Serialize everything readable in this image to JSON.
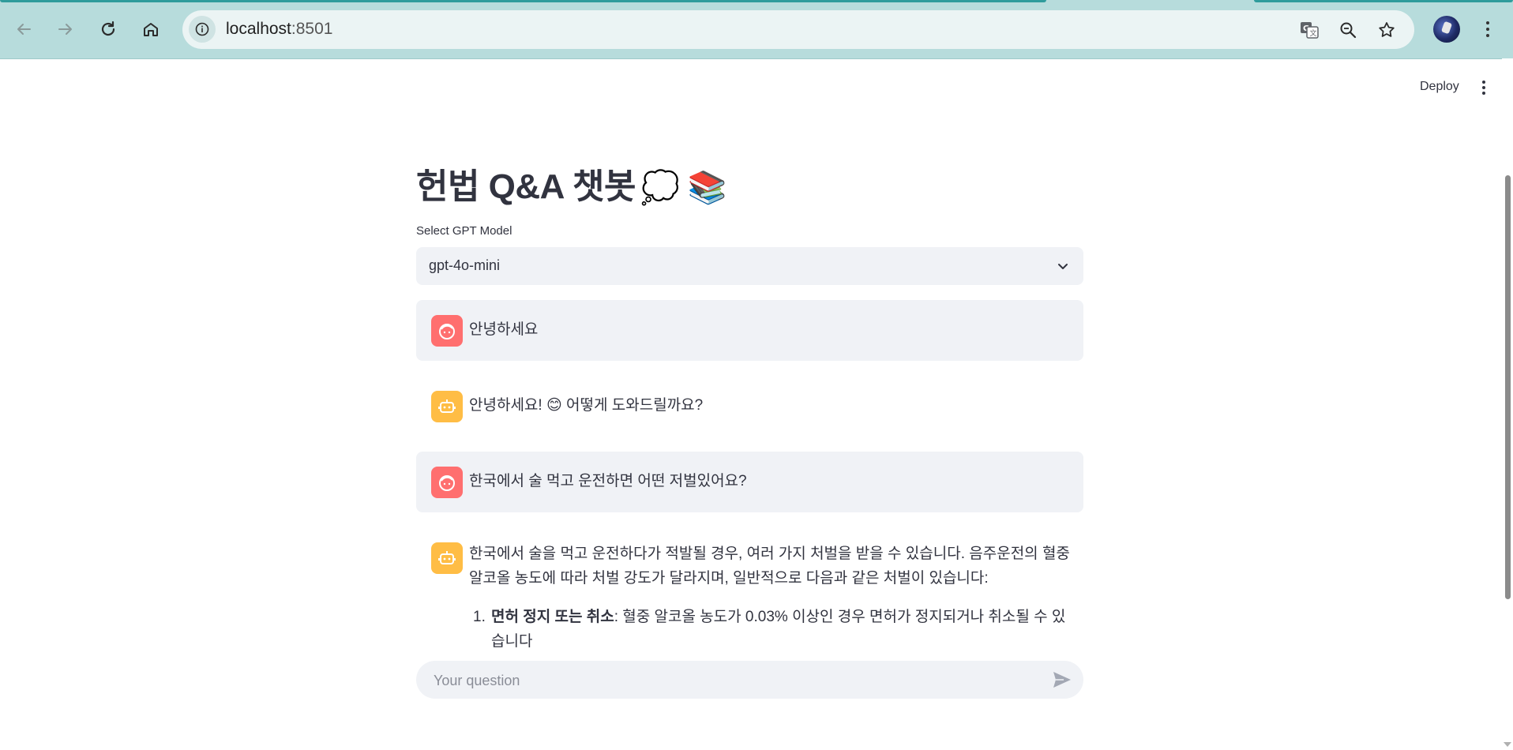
{
  "browser": {
    "url_host": "localhost",
    "url_port": ":8501"
  },
  "app": {
    "deploy_label": "Deploy",
    "title": "헌법 Q&A 챗봇",
    "title_emojis": "💭 📚",
    "select_label": "Select GPT Model",
    "select_value": "gpt-4o-mini",
    "input_placeholder": "Your question"
  },
  "messages": [
    {
      "role": "user",
      "text": "안녕하세요"
    },
    {
      "role": "assistant",
      "text": "안녕하세요! 😊 어떻게 도와드릴까요?"
    },
    {
      "role": "user",
      "text": "한국에서 술 먹고 운전하면 어떤 저벌있어요?"
    },
    {
      "role": "assistant",
      "text": "한국에서 술을 먹고 운전하다가 적발될 경우, 여러 가지 처벌을 받을 수 있습니다. 음주운전의 혈중 알코올 농도에 따라 처벌 강도가 달라지며, 일반적으로 다음과 같은 처벌이 있습니다:"
    }
  ],
  "list": [
    {
      "num": "1.",
      "bold": "면허 정지 또는 취소",
      "rest": ": 혈중 알코올 농도가 0.03% 이상인 경우 면허가 정지되거나 취소될 수 있습니다"
    }
  ],
  "colors": {
    "user_avatar": "#ff6f6f",
    "bot_avatar": "#ffbd45",
    "message_bg": "#f0f2f6",
    "chrome_bg": "#b7dcdc"
  }
}
